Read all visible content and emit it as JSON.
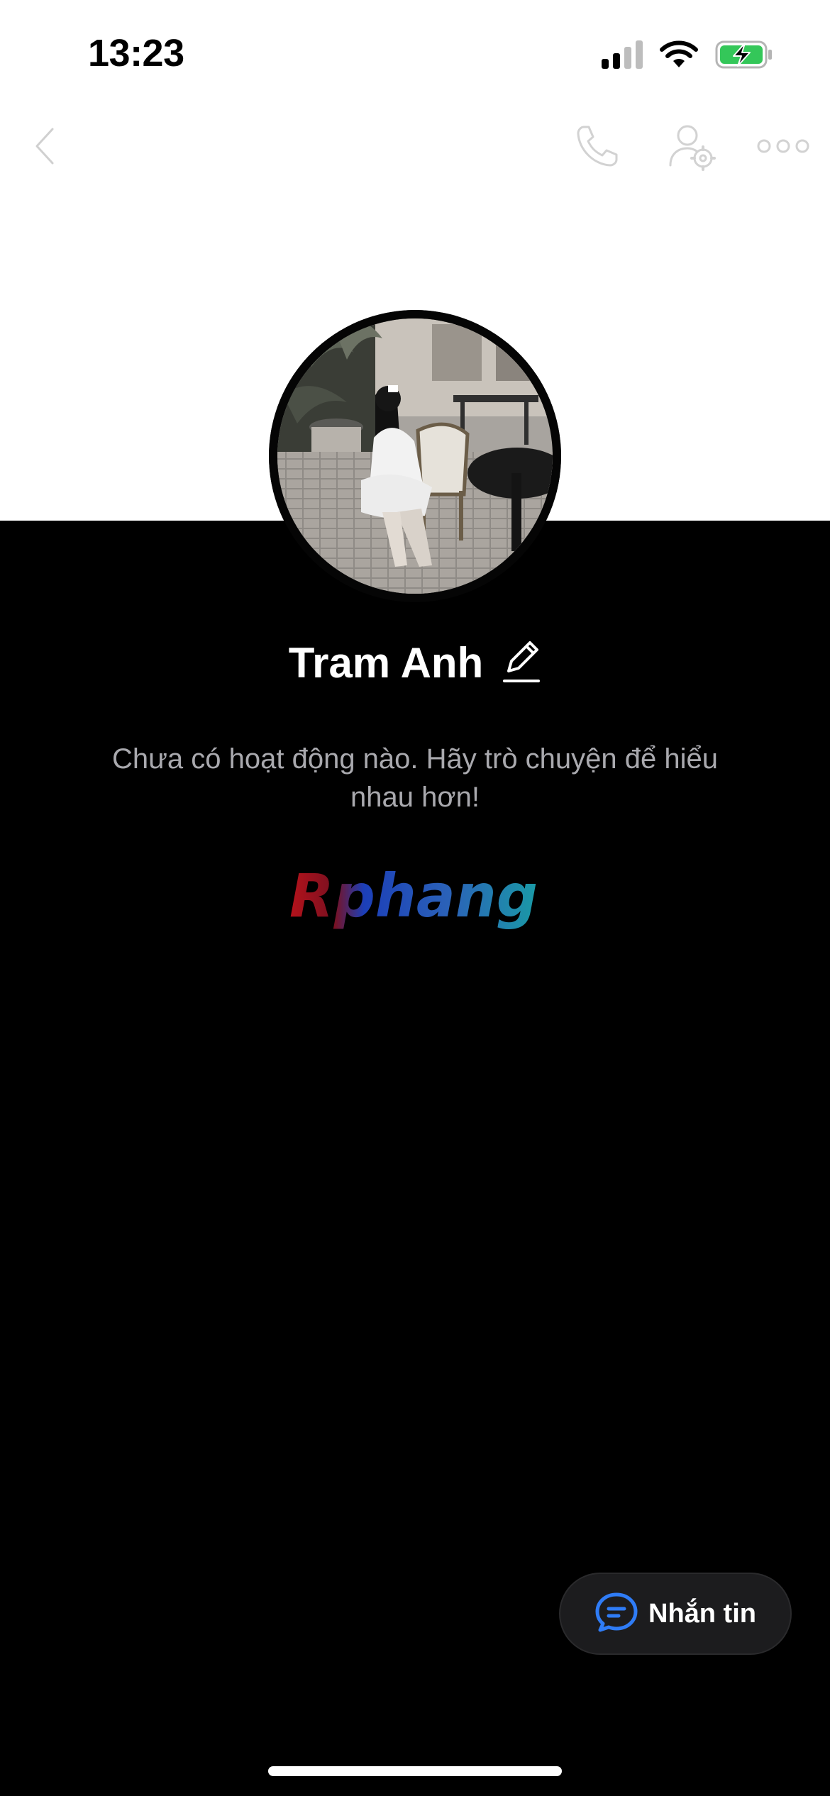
{
  "status_bar": {
    "time": "13:23",
    "icons": [
      "cellular-signal-icon",
      "wifi-icon",
      "battery-charging-icon"
    ]
  },
  "nav": {
    "icons": [
      "back-chevron-icon",
      "phone-icon",
      "user-settings-icon",
      "more-icon"
    ]
  },
  "profile": {
    "name": "Tram Anh",
    "empty_activity_text": "Chưa có hoạt động nào. Hãy trò chuyện để hiểu nhau hơn!",
    "watermark_text": "Rphang"
  },
  "actions": {
    "message_label": "Nhắn tin"
  },
  "colors": {
    "accent": "#2f7cf6",
    "battery_green": "#34c759",
    "muted_text": "#a9a9ae",
    "button_bg": "#1c1c1e"
  }
}
